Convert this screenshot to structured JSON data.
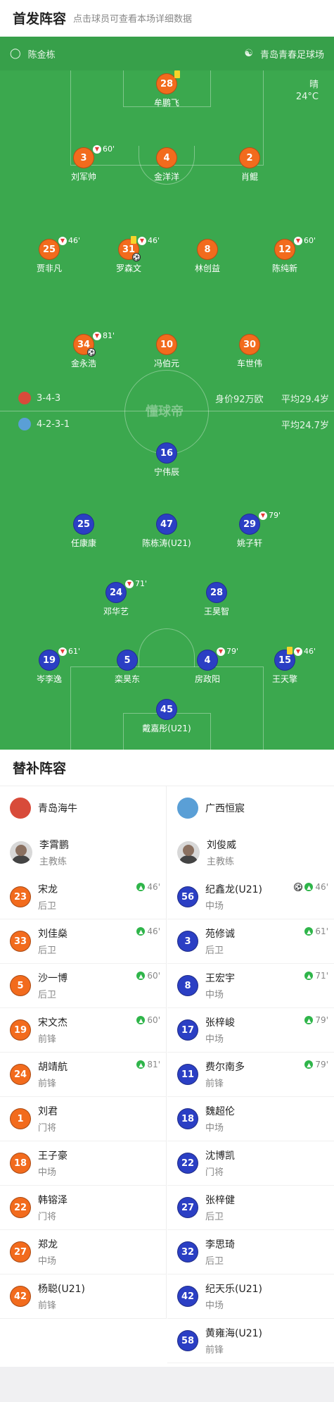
{
  "header": {
    "title": "首发阵容",
    "subtitle": "点击球员可查看本场详细数据"
  },
  "pitch": {
    "referee": "陈金栋",
    "stadium": "青岛青春足球场",
    "weather": "晴",
    "temperature": "24°C",
    "home_formation": "3-4-3",
    "away_formation": "4-2-3-1",
    "market_value": "身价92万欧",
    "home_avg_age": "平均29.4岁",
    "away_avg_age": "平均24.7岁",
    "watermark": "懂球帝"
  },
  "home_players": [
    {
      "num": "28",
      "name": "牟鹏飞",
      "sub": ""
    },
    {
      "num": "3",
      "name": "刘军帅",
      "sub": "60'"
    },
    {
      "num": "4",
      "name": "金洋洋",
      "sub": ""
    },
    {
      "num": "2",
      "name": "肖鲲",
      "sub": ""
    },
    {
      "num": "25",
      "name": "贾非凡",
      "sub": "46'"
    },
    {
      "num": "31",
      "name": "罗森文",
      "sub": "46'"
    },
    {
      "num": "8",
      "name": "林创益",
      "sub": ""
    },
    {
      "num": "12",
      "name": "陈纯新",
      "sub": "60'"
    },
    {
      "num": "34",
      "name": "金永浩",
      "sub": "81'"
    },
    {
      "num": "10",
      "name": "冯伯元",
      "sub": ""
    },
    {
      "num": "30",
      "name": "车世伟",
      "sub": ""
    }
  ],
  "away_players": [
    {
      "num": "16",
      "name": "宁伟辰",
      "sub": ""
    },
    {
      "num": "25",
      "name": "任康康",
      "sub": ""
    },
    {
      "num": "47",
      "name": "陈栋涛(U21)",
      "sub": ""
    },
    {
      "num": "29",
      "name": "姚子轩",
      "sub": "79'"
    },
    {
      "num": "24",
      "name": "邓华艺",
      "sub": "71'"
    },
    {
      "num": "28",
      "name": "王昊智",
      "sub": ""
    },
    {
      "num": "19",
      "name": "岑李逸",
      "sub": "61'"
    },
    {
      "num": "5",
      "name": "栾昊东",
      "sub": ""
    },
    {
      "num": "4",
      "name": "房政阳",
      "sub": "79'"
    },
    {
      "num": "15",
      "name": "王天擎",
      "sub": "46'"
    },
    {
      "num": "45",
      "name": "戴嘉彤(U21)",
      "sub": ""
    }
  ],
  "subs": {
    "title": "替补阵容",
    "home": {
      "team": "青岛海牛",
      "coach": {
        "name": "李霄鹏",
        "role": "主教练"
      },
      "players": [
        {
          "num": "23",
          "name": "宋龙",
          "pos": "后卫",
          "in": "46'"
        },
        {
          "num": "33",
          "name": "刘佳燊",
          "pos": "后卫",
          "in": "46'"
        },
        {
          "num": "5",
          "name": "沙一博",
          "pos": "后卫",
          "in": "60'"
        },
        {
          "num": "19",
          "name": "宋文杰",
          "pos": "前锋",
          "in": "60'"
        },
        {
          "num": "24",
          "name": "胡靖航",
          "pos": "前锋",
          "in": "81'"
        },
        {
          "num": "1",
          "name": "刘君",
          "pos": "门将",
          "in": ""
        },
        {
          "num": "18",
          "name": "王子豪",
          "pos": "中场",
          "in": ""
        },
        {
          "num": "22",
          "name": "韩镕泽",
          "pos": "门将",
          "in": ""
        },
        {
          "num": "27",
          "name": "郑龙",
          "pos": "中场",
          "in": ""
        },
        {
          "num": "42",
          "name": "杨聪(U21)",
          "pos": "前锋",
          "in": ""
        }
      ]
    },
    "away": {
      "team": "广西恒宸",
      "coach": {
        "name": "刘俊威",
        "role": "主教练"
      },
      "players": [
        {
          "num": "56",
          "name": "纪鑫龙(U21)",
          "pos": "中场",
          "in": "46'"
        },
        {
          "num": "3",
          "name": "苑修诚",
          "pos": "后卫",
          "in": "61'"
        },
        {
          "num": "8",
          "name": "王宏宇",
          "pos": "中场",
          "in": "71'"
        },
        {
          "num": "17",
          "name": "张梓峻",
          "pos": "中场",
          "in": "79'"
        },
        {
          "num": "11",
          "name": "费尔南多",
          "pos": "前锋",
          "in": "79'"
        },
        {
          "num": "18",
          "name": "魏超伦",
          "pos": "中场",
          "in": ""
        },
        {
          "num": "22",
          "name": "沈博凯",
          "pos": "门将",
          "in": ""
        },
        {
          "num": "27",
          "name": "张梓健",
          "pos": "后卫",
          "in": ""
        },
        {
          "num": "32",
          "name": "李思琦",
          "pos": "后卫",
          "in": ""
        },
        {
          "num": "42",
          "name": "纪天乐(U21)",
          "pos": "中场",
          "in": ""
        },
        {
          "num": "58",
          "name": "黄雍海(U21)",
          "pos": "前锋",
          "in": ""
        }
      ]
    }
  },
  "colors": {
    "home": "#f26b1d",
    "away": "#2b3fc4",
    "pitch": "#3ba84e"
  }
}
